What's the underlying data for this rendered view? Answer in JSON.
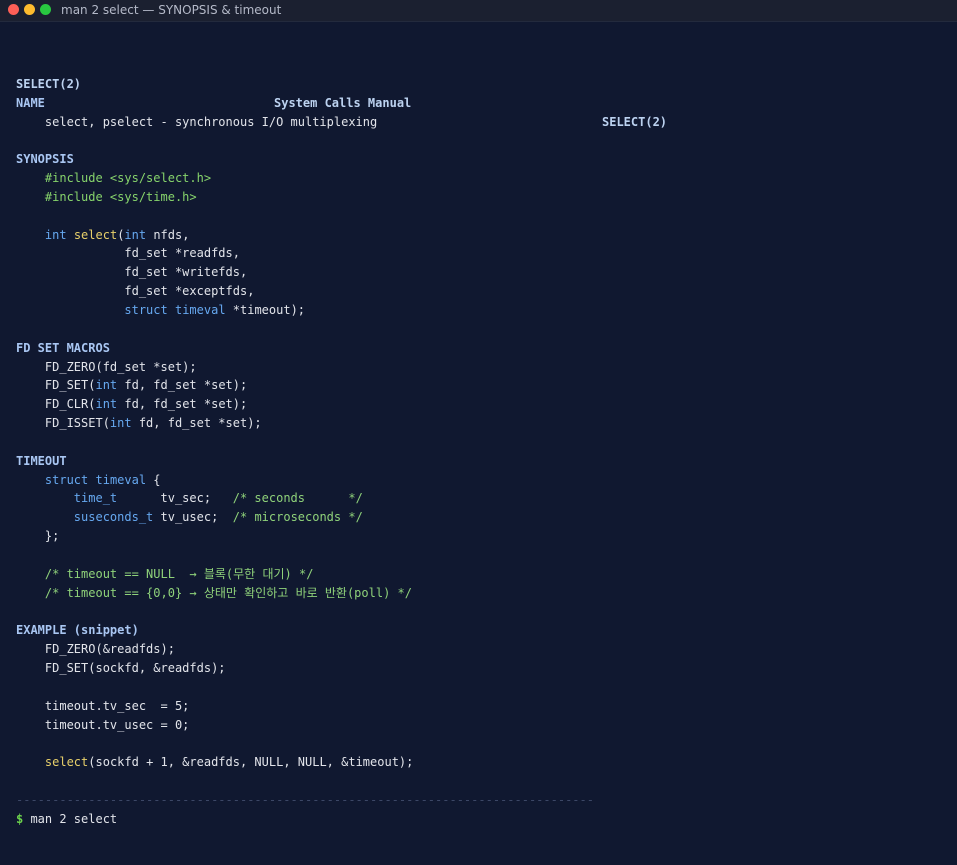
{
  "window": {
    "title": "man 2 select — SYNOPSIS & timeout",
    "controls": [
      "close",
      "minimize",
      "zoom"
    ]
  },
  "header": {
    "left": "SELECT(2)",
    "center": "System Calls Manual",
    "right": "SELECT(2)"
  },
  "name": {
    "heading": "NAME",
    "text": "    select, pselect - synchronous I/O multiplexing"
  },
  "synopsis": {
    "heading": "SYNOPSIS",
    "includes": [
      "    #include <sys/select.h>",
      "    #include <sys/time.h>"
    ],
    "sig": {
      "line1_indent": "    ",
      "line1_kw": "int",
      "line1_sp": " ",
      "line1_fn": "select",
      "line1_rest": "(int nfds,",
      "line1_paren": "(",
      "line1_kw2": "int",
      "line1_tail": " nfds,",
      "line2": "               fd_set *readfds,",
      "line3": "               fd_set *writefds,",
      "line4": "               fd_set *exceptfds,",
      "line5_indent": "               ",
      "line5_kw": "struct",
      "line5_sp": " ",
      "line5_type": "timeval",
      "line5_tail": " *timeout);"
    }
  },
  "macros": {
    "heading": "FD SET MACROS",
    "zero": "    FD_ZERO(fd_set *set);",
    "set_a": "    FD_SET(",
    "set_kw": "int",
    "set_b": " fd, fd_set *set);",
    "clr_a": "    FD_CLR(",
    "clr_kw": "int",
    "clr_b": " fd, fd_set *set);",
    "isset_a": "    FD_ISSET(",
    "isset_kw": "int",
    "isset_b": " fd, fd_set *set);"
  },
  "timeout": {
    "heading": "TIMEOUT",
    "struct_indent": "    ",
    "struct_kw": "struct",
    "struct_sp": " ",
    "struct_type": "timeval",
    "struct_tail": " {",
    "sec_indent": "        ",
    "sec_type": "time_t",
    "sec_field": "      tv_sec;   ",
    "sec_comment": "/* seconds      */",
    "usec_indent": "        ",
    "usec_type": "suseconds_t",
    "usec_field": " tv_usec;  ",
    "usec_comment": "/* microseconds */",
    "close": "    };",
    "note1": "    /* timeout == NULL  → 블록(무한 대기) */",
    "note2": "    /* timeout == {0,0} → 상태만 확인하고 바로 반환(poll) */"
  },
  "example": {
    "heading": "EXAMPLE (snippet)",
    "l1": "    FD_ZERO(&readfds);",
    "l2": "    FD_SET(sockfd, &readfds);",
    "l3": "    timeout.tv_sec  = 5;",
    "l4": "    timeout.tv_usec = 0;",
    "sel_indent": "    ",
    "sel_fn": "select",
    "sel_tail": "(sockfd + 1, &readfds, NULL, NULL, &timeout);"
  },
  "footer": {
    "divider": "--------------------------------------------------------------------------------",
    "prompt": "$",
    "command": " man 2 select"
  }
}
